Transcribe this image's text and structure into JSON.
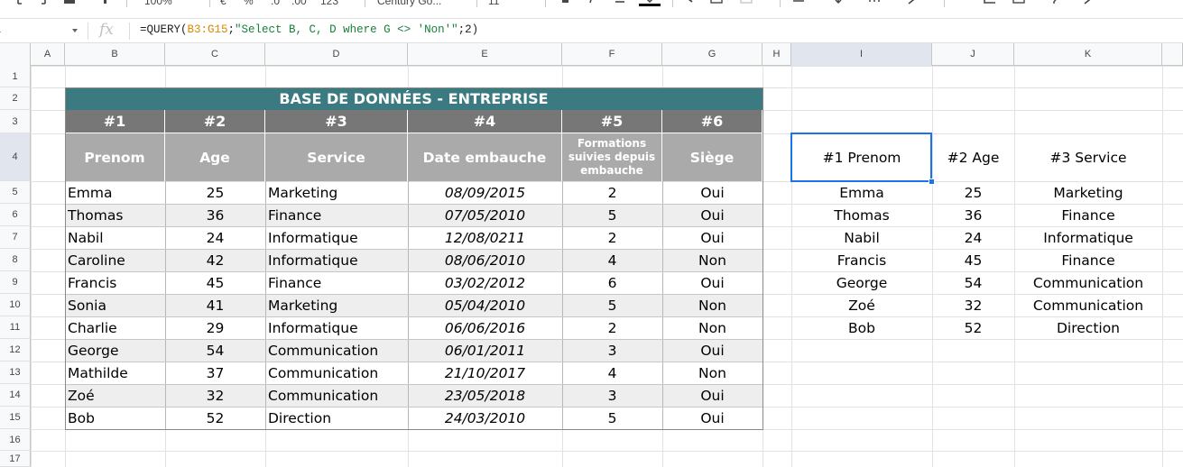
{
  "toolbar": {
    "zoom": "100%",
    "currency": "€",
    "percent": "%",
    "decimals_less": ".0",
    "decimals_more": ".00",
    "number_format": "123",
    "font_name": "Century Go...",
    "font_size": "11"
  },
  "formula_bar": {
    "name_box": "I4",
    "fx": "fx",
    "formula_prefix": "=QUERY(",
    "formula_range": "B3:G15",
    "formula_sep": ";",
    "formula_string": "\"Select B, C, D where G <> 'Non'\"",
    "formula_suffix": ";2)"
  },
  "columns": [
    "A",
    "B",
    "C",
    "D",
    "E",
    "F",
    "G",
    "H",
    "I",
    "J",
    "K"
  ],
  "rows": [
    "1",
    "2",
    "3",
    "4",
    "5",
    "6",
    "7",
    "8",
    "9",
    "10",
    "11",
    "12",
    "13",
    "14",
    "15",
    "16",
    "17"
  ],
  "selected": {
    "column": "I",
    "row": "4"
  },
  "table": {
    "title": "BASE DE DONNÉES - ENTREPRISE",
    "numbers": [
      "#1",
      "#2",
      "#3",
      "#4",
      "#5",
      "#6"
    ],
    "headers": [
      "Prenom",
      "Age",
      "Service",
      "Date embauche",
      "Formations suivies depuis embauche",
      "Siège"
    ],
    "rows": [
      [
        "Emma",
        "25",
        "Marketing",
        "08/09/2015",
        "2",
        "Oui"
      ],
      [
        "Thomas",
        "36",
        "Finance",
        "07/05/2010",
        "5",
        "Oui"
      ],
      [
        "Nabil",
        "24",
        "Informatique",
        "12/08/0211",
        "2",
        "Oui"
      ],
      [
        "Caroline",
        "42",
        "Informatique",
        "08/06/2010",
        "4",
        "Non"
      ],
      [
        "Francis",
        "45",
        "Finance",
        "03/02/2012",
        "6",
        "Oui"
      ],
      [
        "Sonia",
        "41",
        "Marketing",
        "05/04/2010",
        "5",
        "Non"
      ],
      [
        "Charlie",
        "29",
        "Informatique",
        "06/06/2016",
        "2",
        "Non"
      ],
      [
        "George",
        "54",
        "Communication",
        "06/01/2011",
        "3",
        "Oui"
      ],
      [
        "Mathilde",
        "37",
        "Communication",
        "21/10/2017",
        "4",
        "Non"
      ],
      [
        "Zoé",
        "32",
        "Communication",
        "23/05/2018",
        "3",
        "Oui"
      ],
      [
        "Bob",
        "52",
        "Direction",
        "24/03/2010",
        "5",
        "Oui"
      ]
    ]
  },
  "query_result": {
    "headers": [
      "#1 Prenom",
      "#2 Age",
      "#3 Service"
    ],
    "rows": [
      [
        "Emma",
        "25",
        "Marketing"
      ],
      [
        "Thomas",
        "36",
        "Finance"
      ],
      [
        "Nabil",
        "24",
        "Informatique"
      ],
      [
        "Francis",
        "45",
        "Finance"
      ],
      [
        "George",
        "54",
        "Communication"
      ],
      [
        "Zoé",
        "32",
        "Communication"
      ],
      [
        "Bob",
        "52",
        "Direction"
      ]
    ]
  },
  "colors": {
    "title_bg": "#3a7a80",
    "number_bg": "#777777",
    "header_bg": "#aaaaaa",
    "stripe_bg": "#eeeeee",
    "selection": "#1a73e8"
  }
}
